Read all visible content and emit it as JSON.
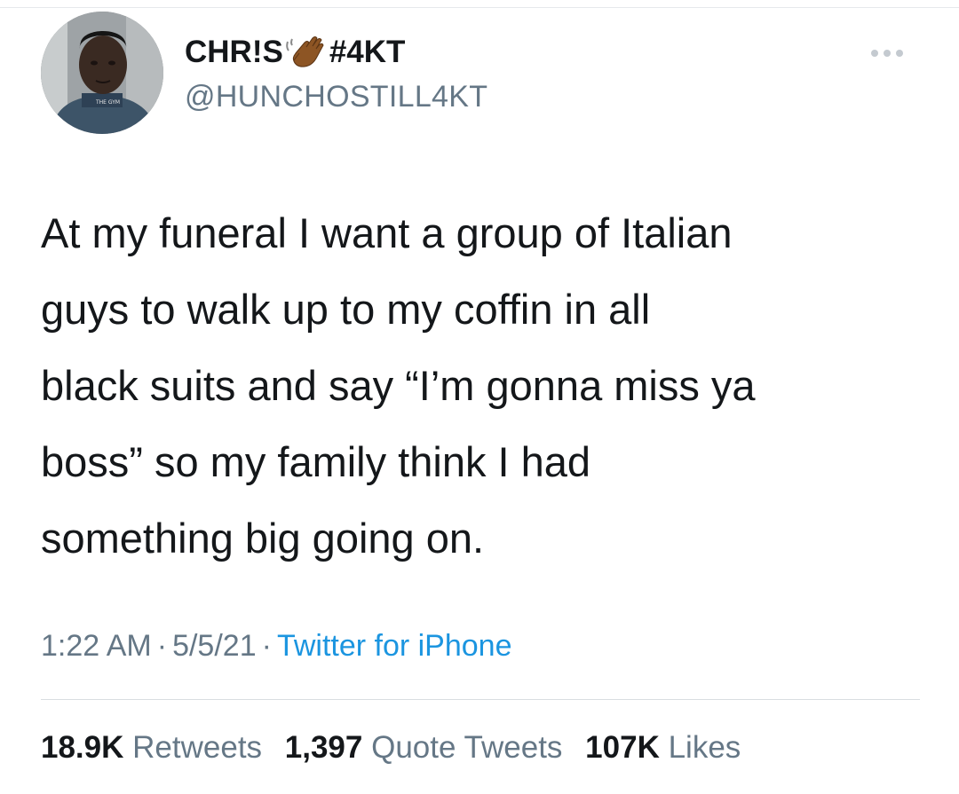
{
  "user": {
    "display_name_prefix": "CHR!S",
    "display_name_emoji": "waving-hand-emoji",
    "display_name_suffix": "#4KT",
    "handle": "@HUNCHOSTILL4KT",
    "avatar_shirt_text": "THE GYM"
  },
  "more_icon": "more-horizontal-icon",
  "tweet": {
    "text": "At my funeral I want a group of Italian\nguys to walk up to my coffin in all\nblack suits and say “I’m gonna miss ya\nboss” so my family think I had\nsomething big going on."
  },
  "meta": {
    "time": "1:22 AM",
    "separator": "·",
    "date": "5/5/21",
    "source": "Twitter for iPhone"
  },
  "stats": {
    "retweets_count": "18.9K",
    "retweets_label": "Retweets",
    "quotes_count": "1,397",
    "quotes_label": "Quote Tweets",
    "likes_count": "107K",
    "likes_label": "Likes"
  },
  "colors": {
    "text_primary": "#14171a",
    "text_secondary": "#657786",
    "link": "#1b95e0",
    "divider": "#d9dde1"
  }
}
